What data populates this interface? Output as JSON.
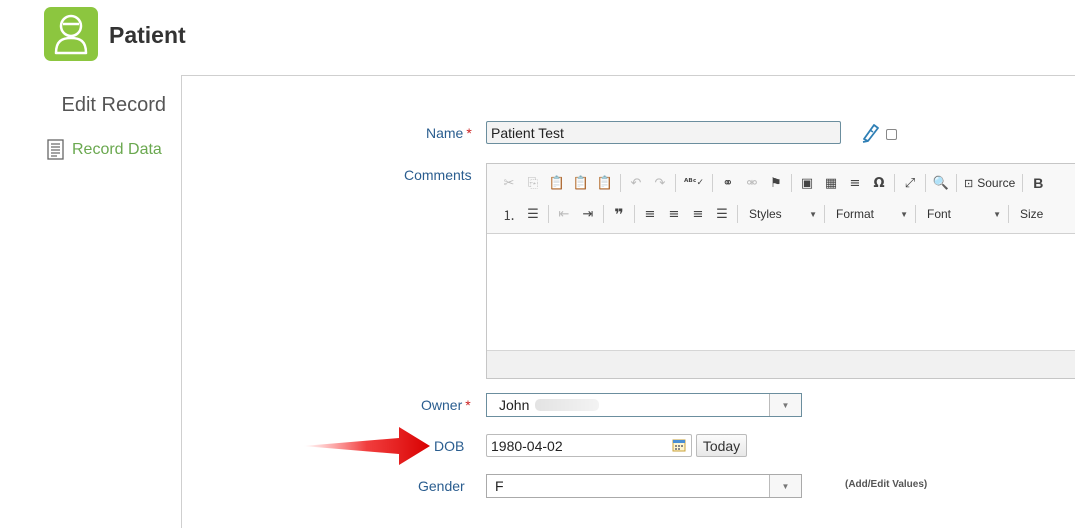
{
  "header": {
    "title": "Patient",
    "icon": "patient-icon",
    "accent": "#8cc63f"
  },
  "sidebar": {
    "title": "Edit Record",
    "items": [
      {
        "label": "Record Data",
        "icon": "document-icon",
        "color": "#6aa84f"
      }
    ]
  },
  "form": {
    "name": {
      "label": "Name",
      "required": "*",
      "value": "Patient Test"
    },
    "comments": {
      "label": "Comments"
    },
    "editor": {
      "toolbar_row1": [
        "cut",
        "copy",
        "paste",
        "paste-text",
        "paste-word",
        "undo",
        "redo",
        "spellcheck",
        "link",
        "unlink",
        "anchor",
        "image",
        "table",
        "horizontal-rule",
        "special-char",
        "maximize",
        "preview"
      ],
      "source_label": "Source",
      "bold_label": "B",
      "styles_label": "Styles",
      "format_label": "Format",
      "font_label": "Font",
      "size_label": "Size"
    },
    "owner": {
      "label": "Owner",
      "required": "*",
      "value": "John"
    },
    "dob": {
      "label": "DOB",
      "value": "1980-04-02",
      "today_label": "Today"
    },
    "gender": {
      "label": "Gender",
      "value": "F",
      "add_edit_label": "(Add/Edit Values)"
    }
  }
}
